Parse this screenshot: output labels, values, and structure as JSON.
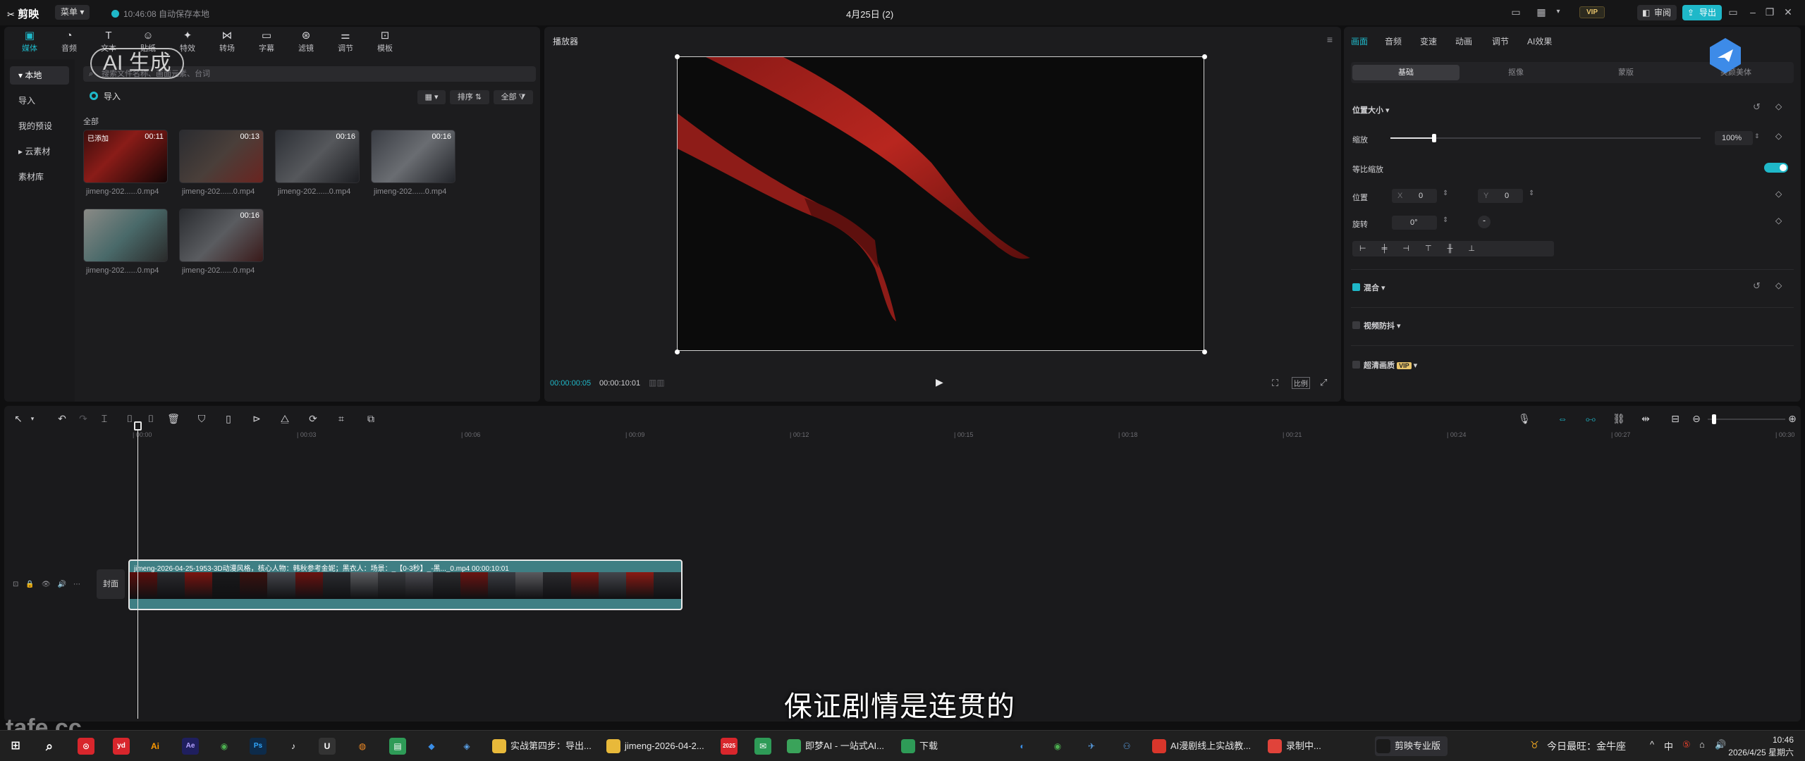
{
  "titlebar": {
    "app_name": "剪映",
    "menu_label": "菜单",
    "save_status": "10:46:08 自动保存本地",
    "project_title": "4月25日 (2)",
    "vip_label": "VIP",
    "review_label": "审阅",
    "export_label": "导出"
  },
  "overlay": {
    "ai_badge": "AI 生成",
    "watermark": "tafe.cc"
  },
  "media": {
    "tabs": [
      {
        "label": "媒体",
        "icon": "media-icon"
      },
      {
        "label": "音频",
        "icon": "audio-icon"
      },
      {
        "label": "文本",
        "icon": "text-icon"
      },
      {
        "label": "贴纸",
        "icon": "sticker-icon"
      },
      {
        "label": "特效",
        "icon": "effects-icon"
      },
      {
        "label": "转场",
        "icon": "transition-icon"
      },
      {
        "label": "字幕",
        "icon": "caption-icon"
      },
      {
        "label": "滤镜",
        "icon": "filter-icon"
      },
      {
        "label": "调节",
        "icon": "adjust-icon"
      },
      {
        "label": "模板",
        "icon": "template-icon"
      }
    ],
    "sidebar": [
      "本地",
      "导入",
      "我的预设",
      "云素材",
      "素材库"
    ],
    "search_placeholder": "搜索文件名称、画面元素、台词",
    "import_label": "导入",
    "sort_label": "排序",
    "filter_label": "全部",
    "section_label": "全部",
    "clips": [
      {
        "name": "jimeng-202......0.mp4",
        "duration": "00:11",
        "tag": "已添加"
      },
      {
        "name": "jimeng-202......0.mp4",
        "duration": "00:13",
        "tag": ""
      },
      {
        "name": "jimeng-202......0.mp4",
        "duration": "00:16",
        "tag": ""
      },
      {
        "name": "jimeng-202......0.mp4",
        "duration": "00:16",
        "tag": ""
      },
      {
        "name": "jimeng-202......0.mp4",
        "duration": "",
        "tag": ""
      },
      {
        "name": "jimeng-202......0.mp4",
        "duration": "00:16",
        "tag": ""
      }
    ]
  },
  "player": {
    "title": "播放器",
    "current_time": "00:00:00:05",
    "total_time": "00:00:10:01",
    "ratio_label": "比例"
  },
  "props": {
    "tabs": [
      "画面",
      "音频",
      "变速",
      "动画",
      "调节",
      "AI效果"
    ],
    "segments": [
      "基础",
      "抠像",
      "蒙版",
      "美颜美体"
    ],
    "section_position": "位置大小",
    "scale_label": "缩放",
    "scale_value": "100%",
    "scale_level": 0.14,
    "uniform_label": "等比缩放",
    "position_label": "位置",
    "pos_x_label": "X",
    "pos_x": "0",
    "pos_y_label": "Y",
    "pos_y": "0",
    "rotate_label": "旋转",
    "rotate_value": "0°",
    "blend_label": "混合",
    "stabilize_label": "视频防抖",
    "enhance_label": "超清画质",
    "enhance_badge": "VIP"
  },
  "timeline": {
    "ruler": [
      "00:00",
      "00:03",
      "00:06",
      "00:09",
      "00:12",
      "00:15",
      "00:18",
      "00:21",
      "00:24",
      "00:27",
      "00:30"
    ],
    "clip_label": "jimeng-2026-04-25-1953-3D动漫风格，核心人物：韩秋参考金妮；黑衣人：场景：_【0-3秒】_-黑..._0.mp4   00:00:10:01",
    "cover_label": "封面",
    "subtitle": "保证剧情是连贯的"
  },
  "taskbar": {
    "windows": [
      {
        "label": "实战第四步：导出...",
        "color": "#e8b93a"
      },
      {
        "label": "jimeng-2026-04-2...",
        "color": "#e8b93a"
      },
      {
        "label": "即梦AI - 一站式AI...",
        "color": "#3aa35a"
      },
      {
        "label": "下载",
        "color": "#2e9b57"
      },
      {
        "label": "AI漫剧线上实战教...",
        "color": "#d9362b"
      },
      {
        "label": "录制中...",
        "color": "#e0433a"
      },
      {
        "label": "剪映专业版",
        "color": "#1a1a1a"
      }
    ],
    "tray_text": "今日最旺：金牛座",
    "ime_label": "中",
    "time": "10:46",
    "date": "2026/4/25 星期六"
  }
}
